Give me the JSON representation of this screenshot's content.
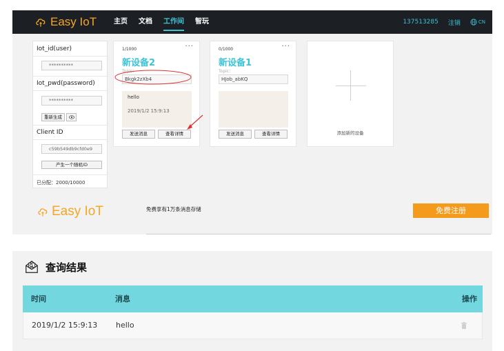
{
  "app": {
    "name": "Easy IoT"
  },
  "nav": {
    "items": [
      "主页",
      "文档",
      "工作间",
      "智玩"
    ],
    "active": "工作间"
  },
  "topbar": {
    "phone": "137513285",
    "logout": "注销",
    "lang": "CN"
  },
  "credentials": {
    "iot_id_label": "Iot_id(user)",
    "iot_id_value": "**********",
    "iot_pwd_label": "Iot_pwd(password)",
    "iot_pwd_value": "**********",
    "regenerate_label": "重新生成",
    "client_id_label": "Client ID",
    "client_id_value": "c59b549db9cfd0e9",
    "random_id_label": "产生一个随机ID",
    "allocated": "已分配：2000/10000"
  },
  "devices": [
    {
      "count": "1/1000",
      "name": "新设备2",
      "topic_label": "Topic：",
      "topic": "Bkgk2zXb4",
      "message": "hello",
      "time": "2019/1/2 15:9:13",
      "send_label": "发送消息",
      "detail_label": "查看详情"
    },
    {
      "count": "0/1000",
      "name": "新设备1",
      "topic_label": "Topic：",
      "topic": "HJob_abKQ",
      "message": "",
      "time": "",
      "send_label": "发送消息",
      "detail_label": "查看详情"
    }
  ],
  "add_device": {
    "label": "添加新的设备"
  },
  "promo": {
    "logo": "Easy IoT",
    "text": "免费享有1万条消息存储",
    "register": "免费注册"
  },
  "result": {
    "title": "查询结果",
    "columns": [
      "时间",
      "消息",
      "操作"
    ],
    "rows": [
      {
        "time": "2019/1/2 15:9:13",
        "message": "hello"
      }
    ]
  },
  "colors": {
    "accent": "#3cc3d6",
    "brand": "#f5a623",
    "register": "#f59b1c",
    "table_header": "#73d7df",
    "annotation": "#e03030"
  },
  "icons": [
    "cloud-logo-icon",
    "globe-icon",
    "more-icon",
    "eye-icon",
    "plus-icon",
    "mail-search-icon",
    "trash-icon"
  ]
}
